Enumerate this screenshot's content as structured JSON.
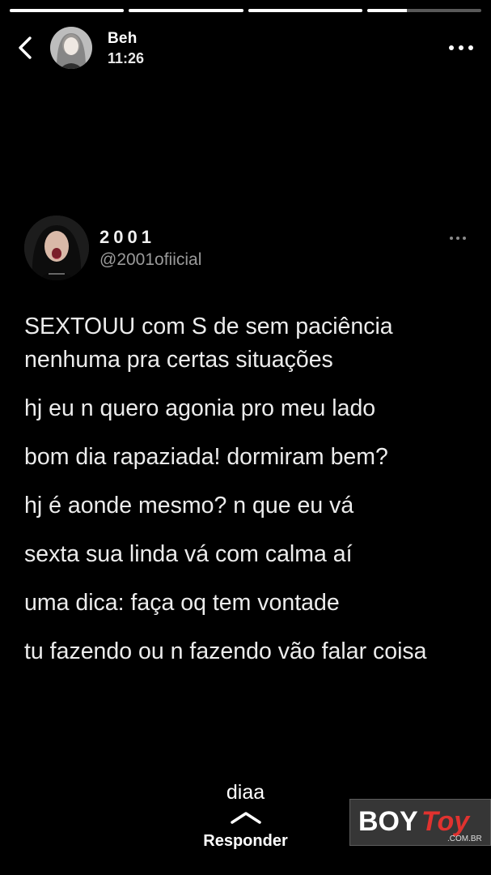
{
  "story": {
    "progress": [
      1,
      1,
      1,
      0.35
    ],
    "user": "Beh",
    "time": "11:26"
  },
  "tweet": {
    "display_name": "2001",
    "handle": "@2001ofiicial",
    "lines": [
      "SEXTOUU com S de sem paciência nenhuma pra certas situações",
      "hj eu n quero agonia pro meu lado",
      "bom dia rapaziada! dormiram bem?",
      "hj é aonde mesmo? n que eu vá",
      "sexta sua linda vá com calma aí",
      "uma dica: faça oq tem vontade",
      "tu fazendo ou n fazendo vão falar coisa"
    ]
  },
  "reply": {
    "preview": "diaa",
    "label": "Responder"
  },
  "watermark": {
    "text": "BOYToy .COM.BR"
  },
  "icons": {
    "back": "back-chevron-icon",
    "more": "more-icon",
    "tweet_more": "tweet-more-icon",
    "reply": "chevron-up-icon"
  },
  "colors": {
    "background": "#000000",
    "handle": "#9a9a9a",
    "watermark_accent": "#e0322f"
  }
}
